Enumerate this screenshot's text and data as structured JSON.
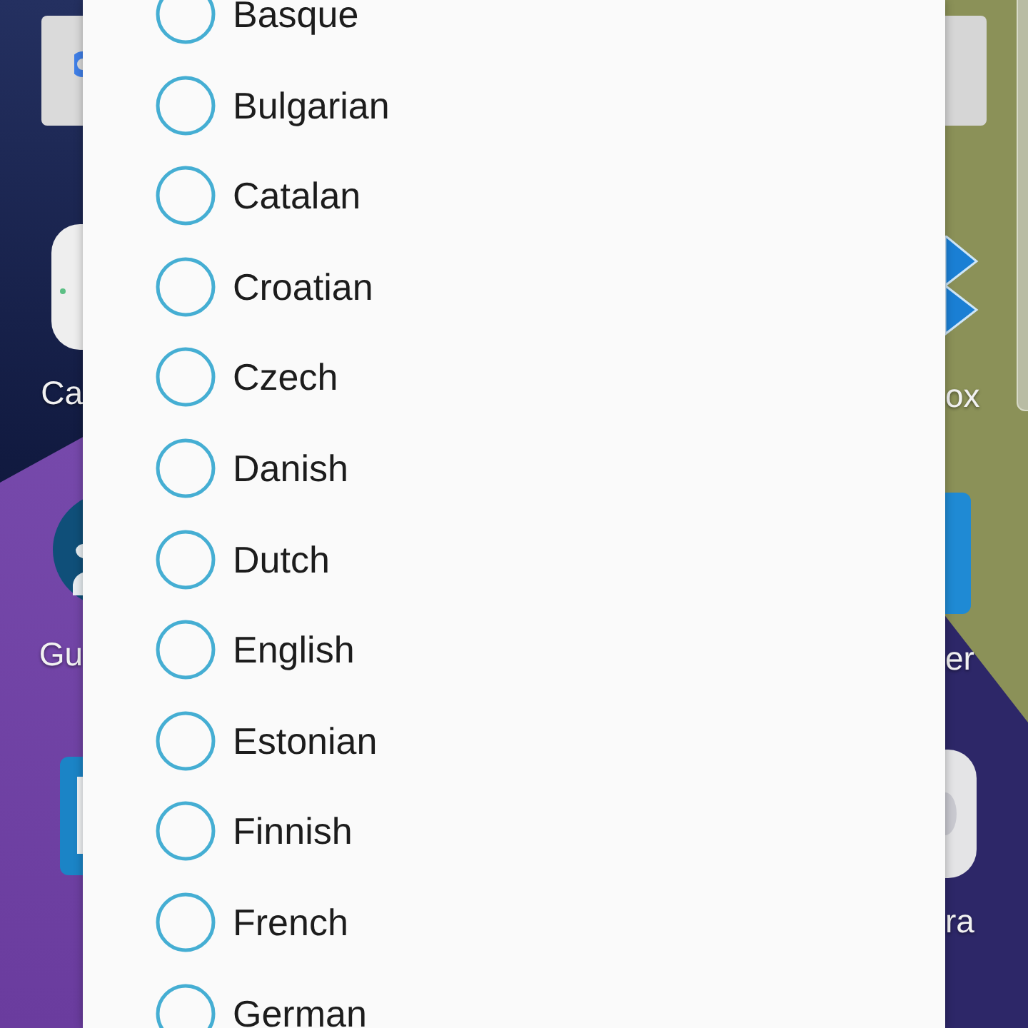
{
  "home_screen": {
    "left_labels": [
      "Ca",
      "Gu"
    ],
    "right_labels": [
      "ox",
      "er",
      "ra"
    ]
  },
  "dialog": {
    "options": [
      {
        "label": "Basque",
        "selected": false
      },
      {
        "label": "Bulgarian",
        "selected": false
      },
      {
        "label": "Catalan",
        "selected": false
      },
      {
        "label": "Croatian",
        "selected": false
      },
      {
        "label": "Czech",
        "selected": false
      },
      {
        "label": "Danish",
        "selected": false
      },
      {
        "label": "Dutch",
        "selected": false
      },
      {
        "label": "English",
        "selected": false
      },
      {
        "label": "Estonian",
        "selected": false
      },
      {
        "label": "Finnish",
        "selected": false
      },
      {
        "label": "French",
        "selected": false
      },
      {
        "label": "German",
        "selected": false
      }
    ]
  }
}
